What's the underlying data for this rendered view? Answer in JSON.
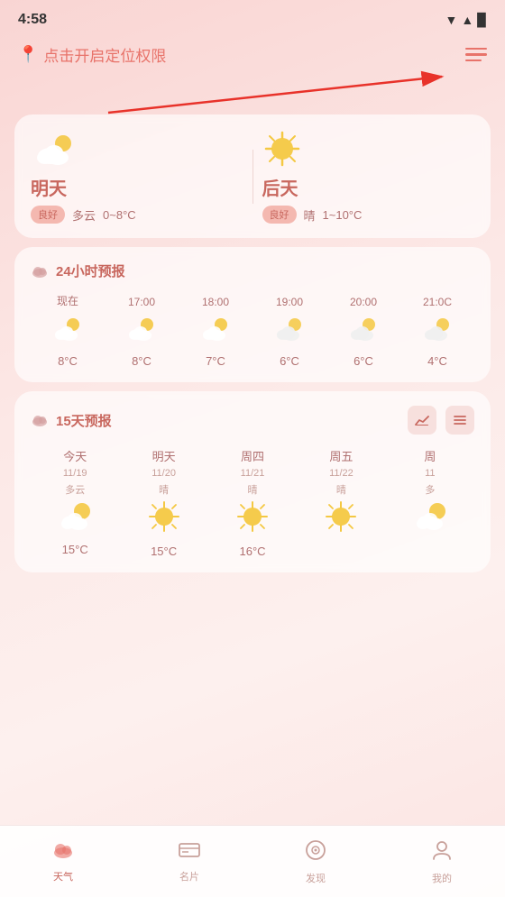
{
  "statusBar": {
    "time": "4:58",
    "icons": [
      "▼",
      "▲",
      "🔋"
    ]
  },
  "header": {
    "locationText": "点击开启定位权限",
    "locationIcon": "📍"
  },
  "twoDayForecast": {
    "tomorrow": {
      "label": "明天",
      "quality": "良好",
      "desc": "多云",
      "tempRange": "0~8°C"
    },
    "dayAfter": {
      "label": "后天",
      "quality": "良好",
      "desc": "晴",
      "tempRange": "1~10°C"
    }
  },
  "hourlyForecast": {
    "title": "24小时预报",
    "items": [
      {
        "time": "现在",
        "temp": "8°C"
      },
      {
        "time": "17:00",
        "temp": "8°C"
      },
      {
        "time": "18:00",
        "temp": "7°C"
      },
      {
        "time": "19:00",
        "temp": "6°C"
      },
      {
        "time": "20:00",
        "temp": "6°C"
      },
      {
        "time": "21:0C",
        "temp": "4°C"
      }
    ]
  },
  "fifteenDayForecast": {
    "title": "15天预报",
    "days": [
      {
        "name": "今天",
        "date": "11/19",
        "weather": "多云",
        "temp": "15°C",
        "iconType": "cloud-sun"
      },
      {
        "name": "明天",
        "date": "11/20",
        "weather": "晴",
        "temp": "15°C",
        "iconType": "sun"
      },
      {
        "name": "周四",
        "date": "11/21",
        "weather": "晴",
        "temp": "16°C",
        "iconType": "sun"
      },
      {
        "name": "周五",
        "date": "11/22",
        "weather": "晴",
        "temp": "",
        "iconType": "sun"
      },
      {
        "name": "周",
        "date": "11",
        "weather": "多",
        "temp": "",
        "iconType": "cloud-sun"
      }
    ]
  },
  "bottomNav": {
    "items": [
      {
        "label": "天气",
        "icon": "cloud",
        "active": true
      },
      {
        "label": "名片",
        "icon": "card",
        "active": false
      },
      {
        "label": "发现",
        "icon": "discover",
        "active": false
      },
      {
        "label": "我的",
        "icon": "profile",
        "active": false
      }
    ]
  }
}
